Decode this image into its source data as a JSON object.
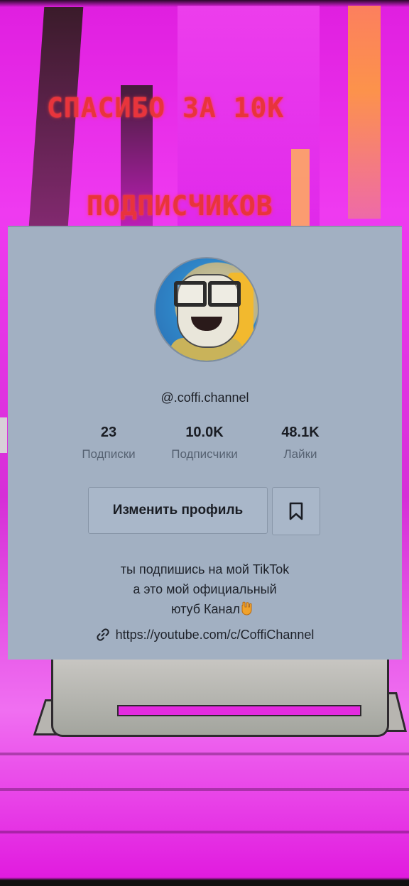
{
  "overlay": {
    "headline_line1": "СПАСИБО ЗА 10К",
    "headline_line2": "ПОДПИСЧИКОВ",
    "color": "#e8343c"
  },
  "profile": {
    "username": "@.coffi.channel",
    "stats": [
      {
        "value": "23",
        "label": "Подписки"
      },
      {
        "value": "10.0K",
        "label": "Подписчики"
      },
      {
        "value": "48.1K",
        "label": "Лайки"
      }
    ],
    "edit_button_label": "Изменить профиль",
    "bookmark_icon": "bookmark-icon",
    "bio_lines": [
      "ты подпишись на мой TikTok",
      "а это мой официальный",
      "ютуб Канал"
    ],
    "bio_emoji": "hand-pointing-down",
    "link_icon": "link-icon",
    "link": "https://youtube.com/c/CoffiChannel",
    "card_color": "#a2b0c2"
  }
}
